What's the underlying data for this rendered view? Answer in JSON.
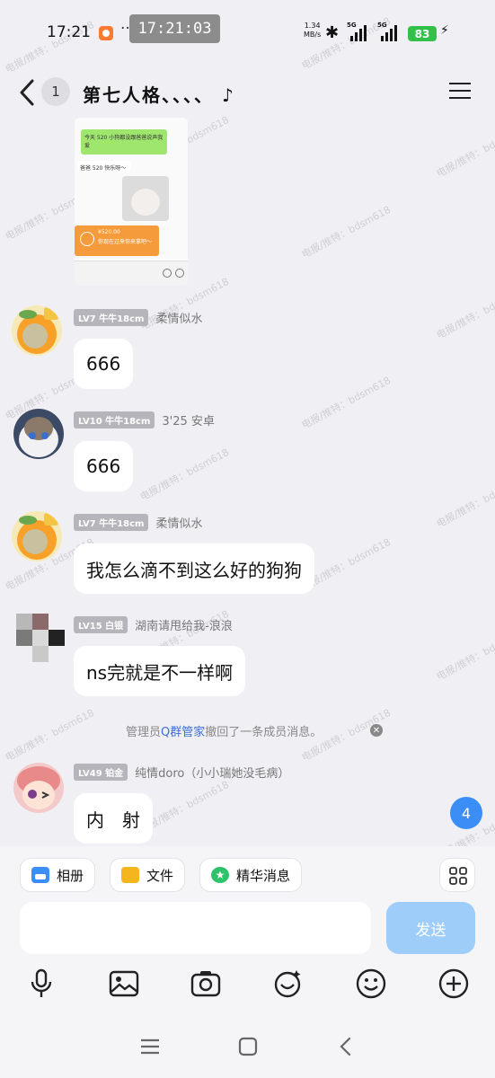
{
  "status_bar": {
    "time": "17:21",
    "dots": "···",
    "recording_time": "17:21:03",
    "net_speed_value": "1.34",
    "net_speed_unit": "MB/s",
    "network_1": "5G",
    "network_2": "5G",
    "battery": "83"
  },
  "header": {
    "unread_count": "1",
    "title": "第七人格、、、、 ♪"
  },
  "shared_image": {
    "green_text": "今天 520 小狗都没跟爸爸说声我爱",
    "white_text": "爸爸 520 快乐呀～",
    "amount": "¥520.00",
    "transfer_note": "你现在过来你来拿吧～"
  },
  "messages": [
    {
      "level": "LV7",
      "title": "牛牛18cm",
      "nickname": "柔情似水",
      "text": "666"
    },
    {
      "level": "LV10",
      "title": "牛牛18cm",
      "nickname": "3'25 安卓",
      "text": "666"
    },
    {
      "level": "LV7",
      "title": "牛牛18cm",
      "nickname": "柔情似水",
      "text": "我怎么滴不到这么好的狗狗"
    },
    {
      "level": "LV15",
      "title": "白银",
      "nickname": "湖南请甩给我-浪浪",
      "text": "ns完就是不一样啊"
    },
    {
      "level": "LV49",
      "title": "铂金",
      "nickname": "纯情doro（小小瑞她没毛病）",
      "text": "内　射"
    }
  ],
  "system_message": {
    "prefix": "管理员",
    "admin": "Q群管家",
    "suffix": "撤回了一条成员消息。"
  },
  "new_message_count": "4",
  "quick_actions": [
    {
      "label": "相册",
      "icon": "album-icon"
    },
    {
      "label": "文件",
      "icon": "folder-icon"
    },
    {
      "label": "精华消息",
      "icon": "star-icon"
    }
  ],
  "composer": {
    "placeholder": "",
    "send_label": "发送"
  },
  "toolbar_icons": [
    "microphone-icon",
    "image-icon",
    "camera-icon",
    "emoji-pack-icon",
    "smiley-icon",
    "plus-icon"
  ],
  "watermark": "电报/推特：bdsm618",
  "colors": {
    "accent": "#3a8ef6",
    "send_disabled": "#9fcdf9",
    "level_tag": "#b5b5bb",
    "admin_link": "#3b6fd6"
  }
}
